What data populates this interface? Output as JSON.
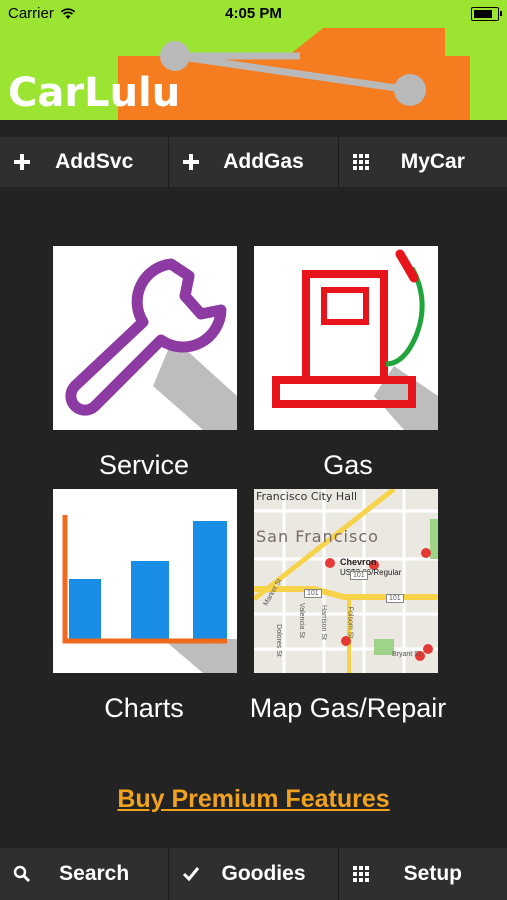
{
  "status": {
    "carrier": "Carrier",
    "time": "4:05 PM"
  },
  "app": {
    "title": "CarLulu"
  },
  "colors": {
    "header_green": "#9be532",
    "car_orange": "#f57c1f",
    "link_orange": "#f1a21e",
    "dark_bg": "#232323"
  },
  "top_toolbar": [
    {
      "label": "AddSvc",
      "icon": "plus-icon"
    },
    {
      "label": "AddGas",
      "icon": "plus-icon"
    },
    {
      "label": "MyCar",
      "icon": "grid-icon"
    }
  ],
  "tiles": [
    {
      "label": "Service",
      "icon": "wrench-icon"
    },
    {
      "label": "Gas",
      "icon": "gas-pump-icon"
    },
    {
      "label": "Charts",
      "icon": "bar-chart-icon"
    },
    {
      "label": "Map Gas/Repair",
      "icon": "map-icon"
    }
  ],
  "map": {
    "area_label": "Francisco City Hall",
    "city_label": "San Francisco",
    "station_name": "Chevron",
    "station_price": "US$3.06/Regular",
    "street_labels": [
      "Market St",
      "Valencia St",
      "Dolores St",
      "Harrison St",
      "Folsom St",
      "Bryant St"
    ],
    "highway_labels": [
      "101",
      "101",
      "101"
    ]
  },
  "premium_link": "Buy Premium Features",
  "bottom_toolbar": [
    {
      "label": "Search",
      "icon": "search-icon"
    },
    {
      "label": "Goodies",
      "icon": "checkmark-icon"
    },
    {
      "label": "Setup",
      "icon": "grid-icon"
    }
  ]
}
